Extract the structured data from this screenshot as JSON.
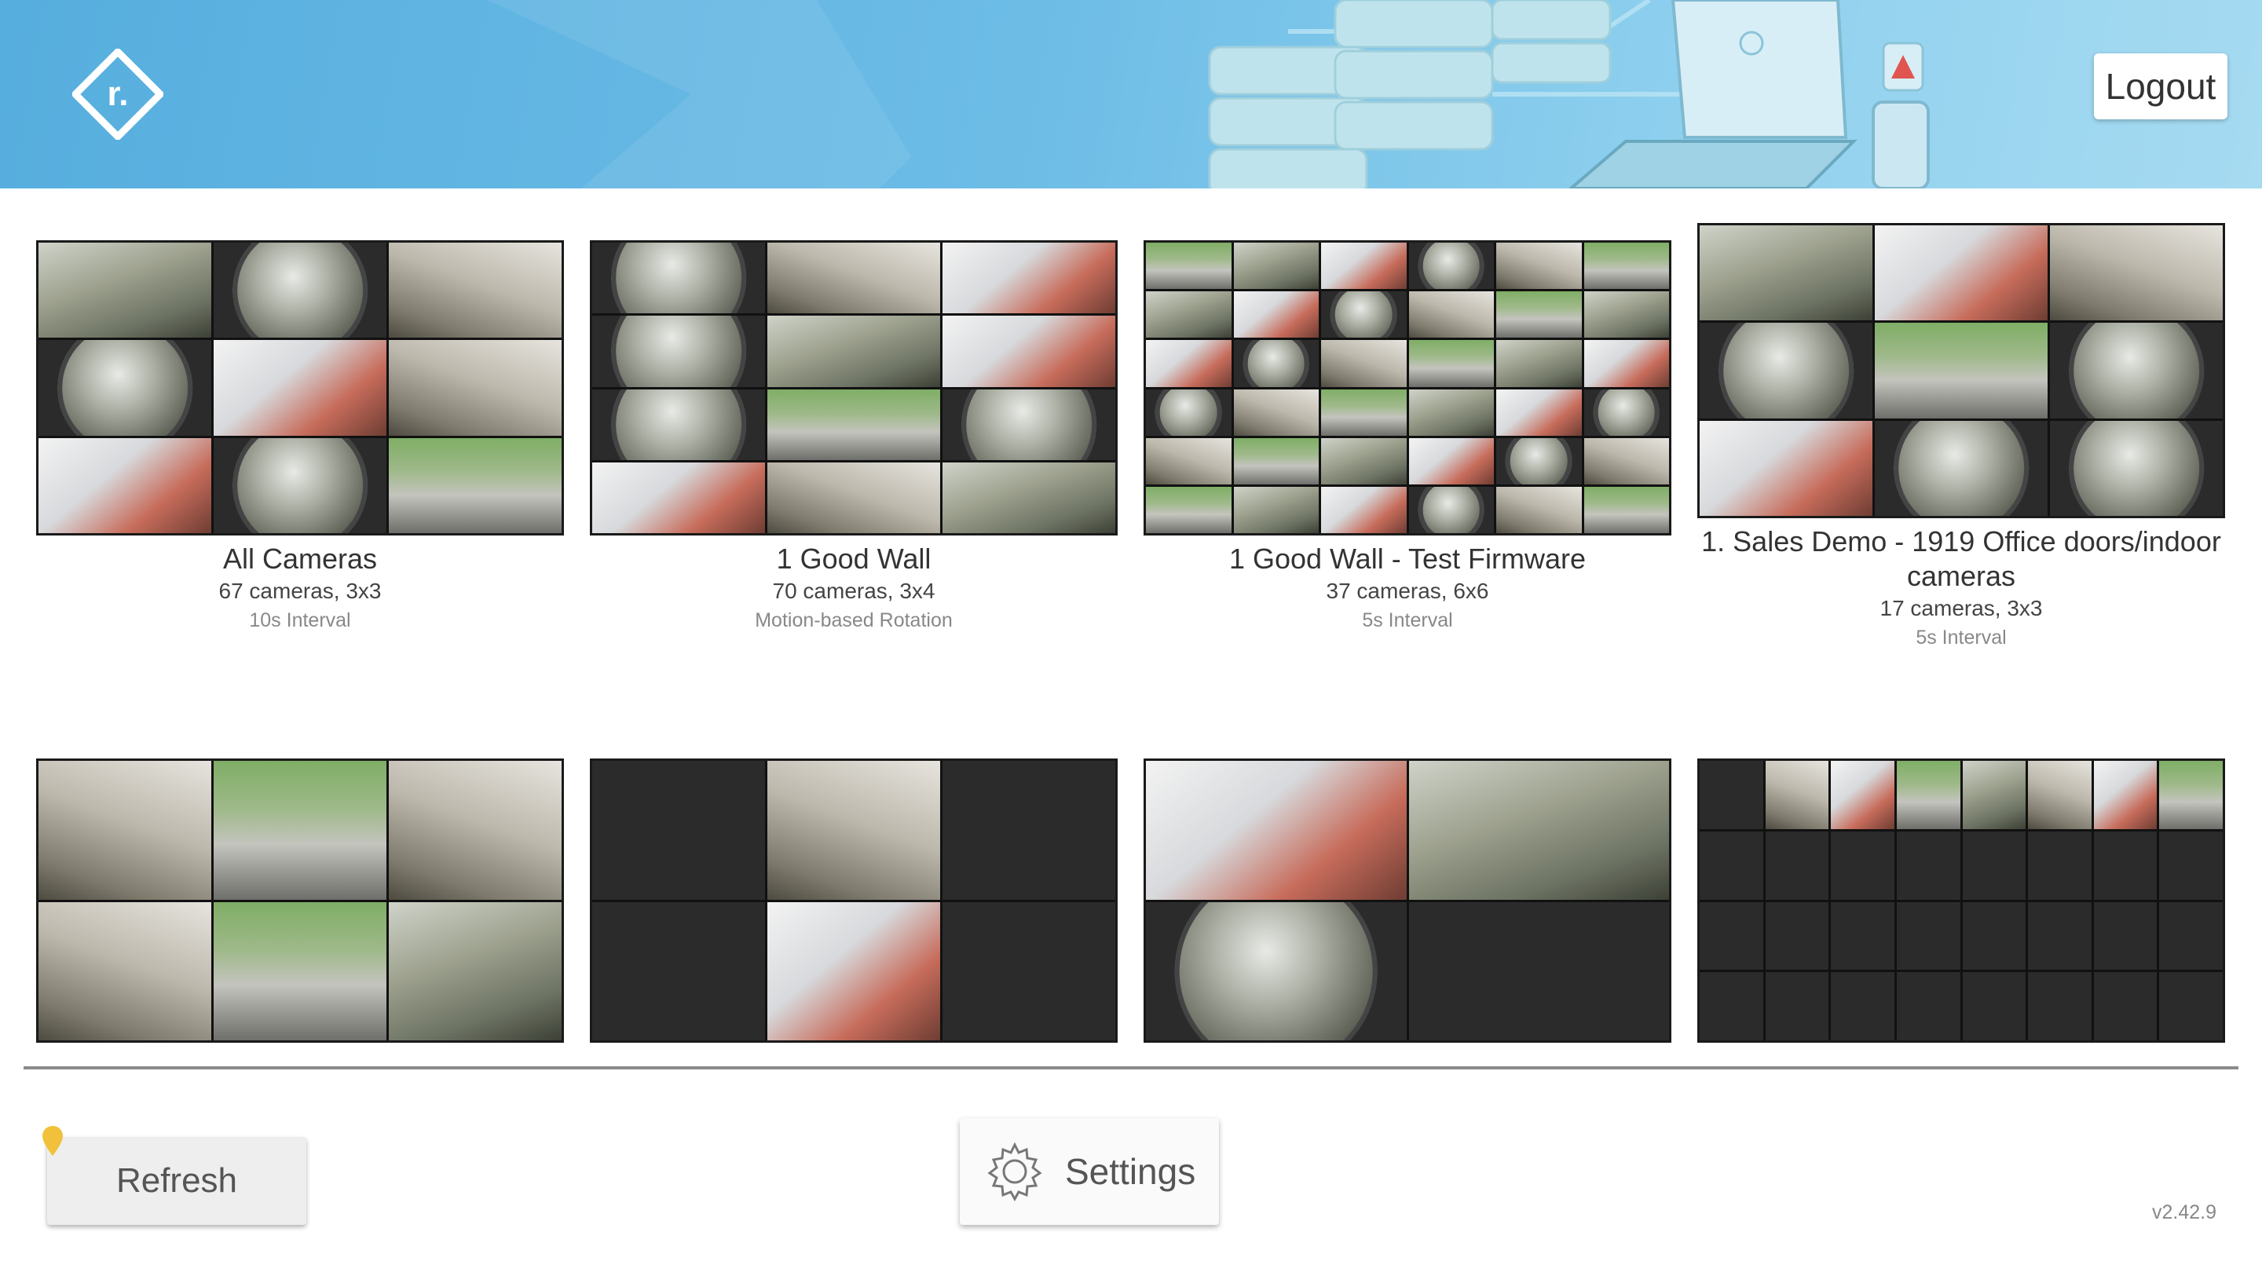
{
  "header": {
    "logo_letter": "r.",
    "logout_label": "Logout"
  },
  "walls": [
    {
      "name": "All Cameras",
      "count": "67 cameras, 3x3",
      "interval": "10s Interval"
    },
    {
      "name": "1 Good Wall",
      "count": "70 cameras, 3x4",
      "interval": "Motion-based Rotation"
    },
    {
      "name": "1 Good Wall - Test Firmware",
      "count": "37 cameras, 6x6",
      "interval": "5s Interval"
    },
    {
      "name": "1. Sales Demo - 1919 Office doors/indoor cameras",
      "count": "17 cameras, 3x3",
      "interval": "5s Interval"
    },
    {
      "name": "",
      "count": "",
      "interval": ""
    },
    {
      "name": "",
      "count": "",
      "interval": ""
    },
    {
      "name": "",
      "count": "",
      "interval": ""
    },
    {
      "name": "",
      "count": "",
      "interval": ""
    }
  ],
  "footer": {
    "refresh_label": "Refresh",
    "settings_label": "Settings",
    "version": "v2.42.9"
  },
  "colors": {
    "header_start": "#56aede",
    "header_end": "#a6dbf1",
    "tile_background": "#2a2a2a",
    "pin": "#f2c13b"
  },
  "icons": {
    "logo": "diamond-r-logo-icon",
    "settings": "gear-icon",
    "pin": "location-pin-icon"
  }
}
